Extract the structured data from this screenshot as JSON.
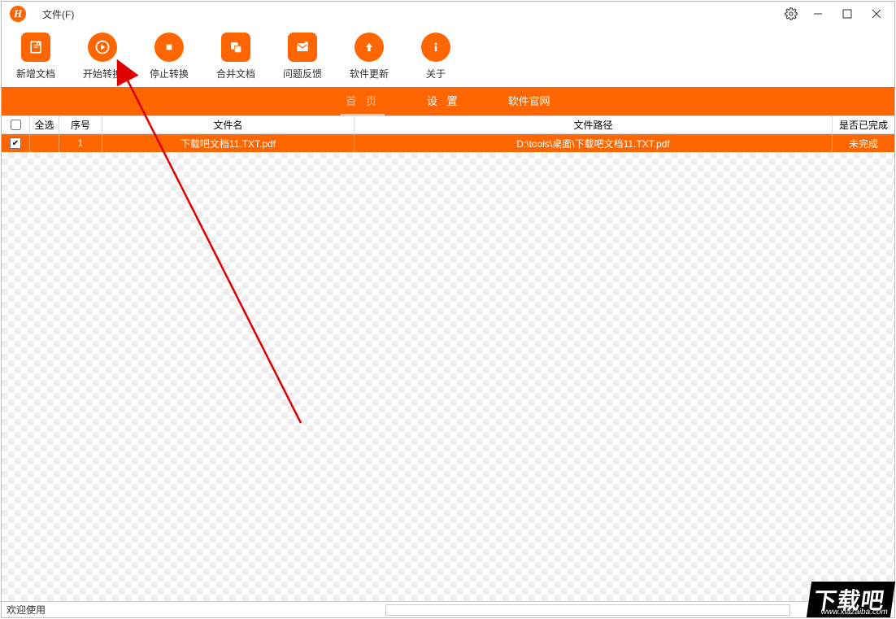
{
  "menu": {
    "file": "文件(F)"
  },
  "toolbar": [
    {
      "key": "new-doc",
      "label": "新增文档"
    },
    {
      "key": "start-convert",
      "label": "开始转换"
    },
    {
      "key": "stop-convert",
      "label": "停止转换"
    },
    {
      "key": "merge-doc",
      "label": "合并文档"
    },
    {
      "key": "feedback",
      "label": "问题反馈"
    },
    {
      "key": "update",
      "label": "软件更新"
    },
    {
      "key": "about",
      "label": "关于"
    }
  ],
  "tabs": {
    "home": "首 页",
    "settings": "设 置",
    "official": "软件官网"
  },
  "table": {
    "headers": {
      "selectAll": "全选",
      "num": "序号",
      "name": "文件名",
      "path": "文件路径",
      "status": "是否已完成"
    },
    "rows": [
      {
        "checked": true,
        "num": "1",
        "name": "下载吧文档11.TXT.pdf",
        "path": "D:\\tools\\桌面\\下载吧文档11.TXT.pdf",
        "status": "未完成"
      }
    ]
  },
  "statusbar": {
    "welcome": "欢迎使用"
  },
  "watermark": {
    "text": "下载吧",
    "url": "www.xiazaiba.com"
  }
}
